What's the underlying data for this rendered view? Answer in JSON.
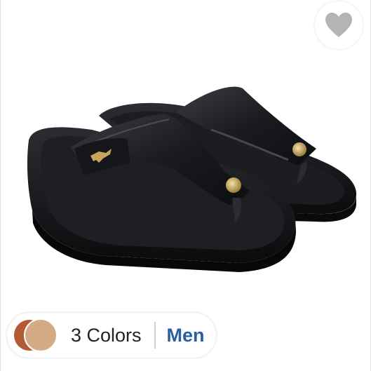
{
  "product": {
    "image_name": "black-thong-sandal-image",
    "colors_label": "3 Colors",
    "gender_label": "Men",
    "swatches": [
      "#b35a35",
      "#d4ab85"
    ]
  },
  "wishlist": {
    "icon": "heart-icon",
    "icon_color": "#b4b4b4"
  },
  "accent_color": "#2a5f9e"
}
